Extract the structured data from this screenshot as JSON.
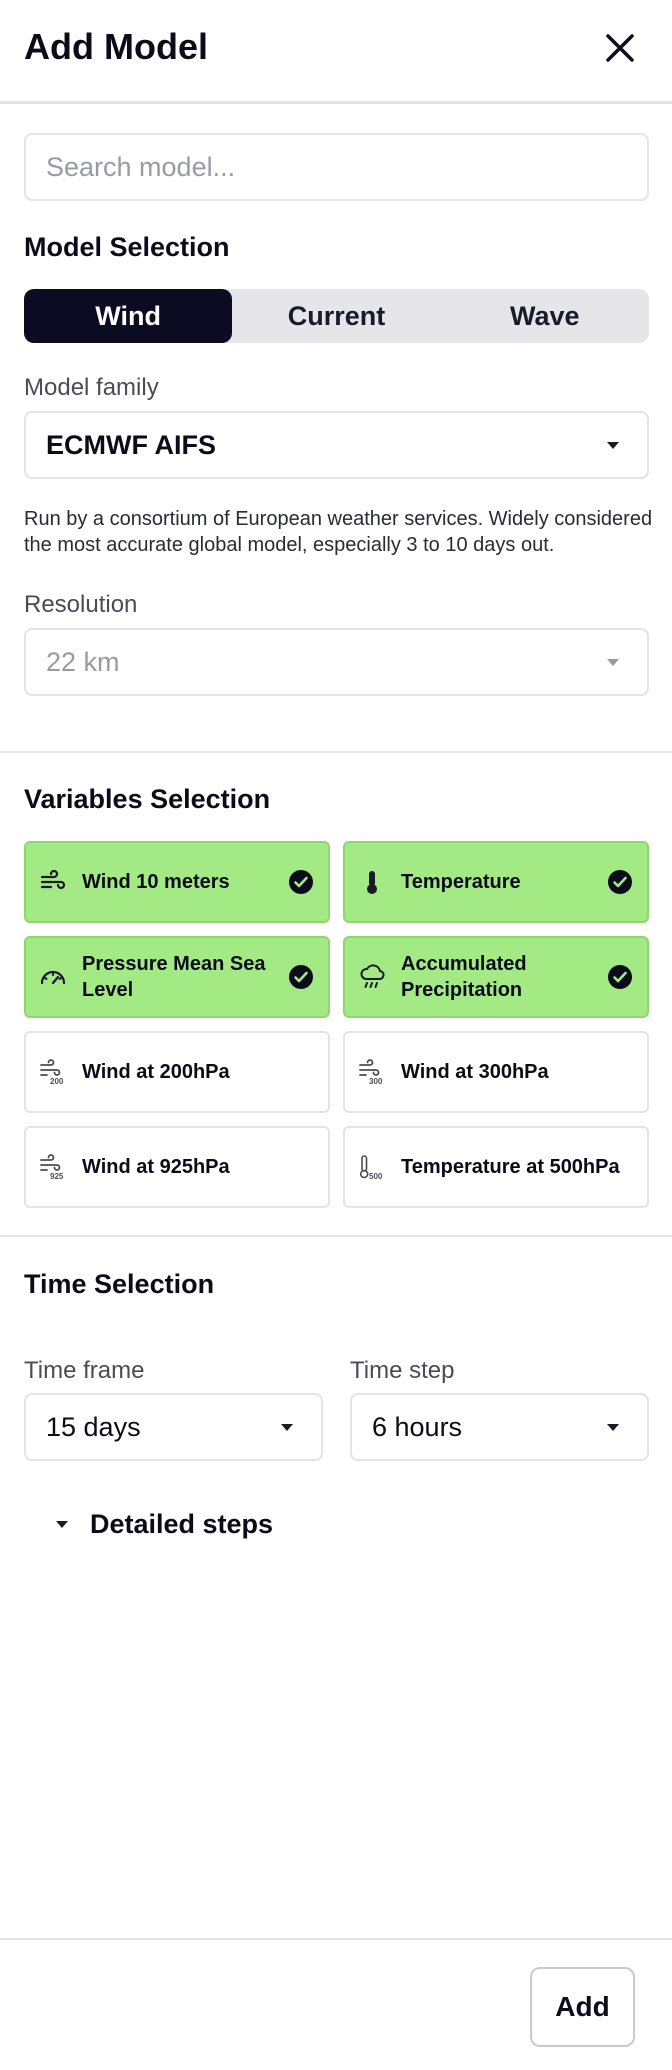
{
  "header": {
    "title": "Add Model"
  },
  "search": {
    "placeholder": "Search model..."
  },
  "model_selection": {
    "title": "Model Selection",
    "tabs": [
      {
        "label": "Wind",
        "active": true
      },
      {
        "label": "Current",
        "active": false
      },
      {
        "label": "Wave",
        "active": false
      }
    ],
    "family_label": "Model family",
    "family_value": "ECMWF AIFS",
    "description": "Run by a consortium of European weather services. Widely considered the most accurate global model, especially 3 to 10 days out.",
    "resolution_label": "Resolution",
    "resolution_value": "22 km"
  },
  "variables": {
    "title": "Variables Selection",
    "items": [
      {
        "label": "Wind 10 meters",
        "icon": "wind-icon",
        "selected": true
      },
      {
        "label": "Temperature",
        "icon": "thermometer-icon",
        "selected": true
      },
      {
        "label": "Pressure Mean Sea Level",
        "icon": "gauge-icon",
        "selected": true
      },
      {
        "label": "Accumulated Precipitation",
        "icon": "rain-cloud-icon",
        "selected": true
      },
      {
        "label": "Wind at 200hPa",
        "icon": "wind-200-icon",
        "badge": "200",
        "selected": false
      },
      {
        "label": "Wind at 300hPa",
        "icon": "wind-300-icon",
        "badge": "300",
        "selected": false
      },
      {
        "label": "Wind at 925hPa",
        "icon": "wind-925-icon",
        "badge": "925",
        "selected": false
      },
      {
        "label": "Temperature at 500hPa",
        "icon": "thermometer-500-icon",
        "badge": "500",
        "selected": false
      }
    ]
  },
  "time": {
    "title": "Time Selection",
    "frame_label": "Time frame",
    "frame_value": "15 days",
    "step_label": "Time step",
    "step_value": "6 hours",
    "details_label": "Detailed steps"
  },
  "footer": {
    "add_label": "Add"
  },
  "colors": {
    "accent": "#0b0b22",
    "selected": "#a3ea85",
    "border": "#e4e4e7"
  }
}
